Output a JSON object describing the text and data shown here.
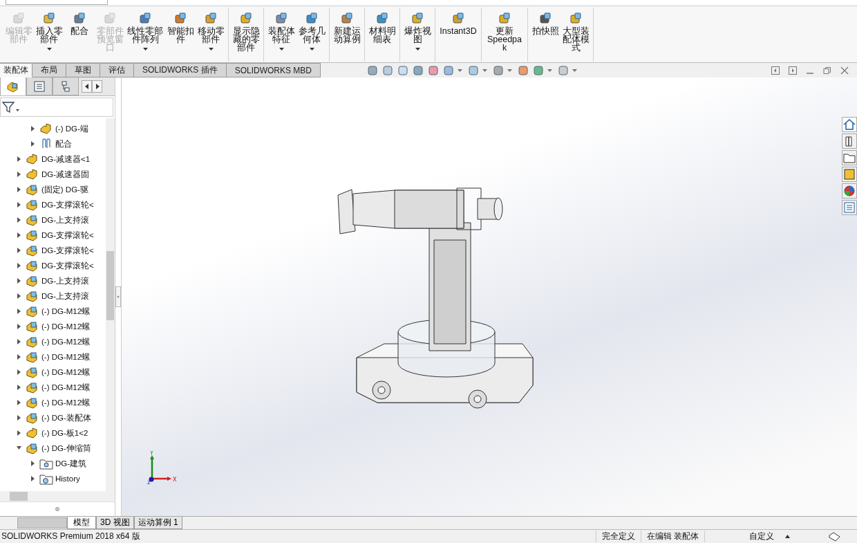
{
  "toolbar": {
    "groups": [
      {
        "items": [
          {
            "label": "编辑零部件",
            "disabled": true,
            "dropdown": false
          },
          {
            "label": "插入零部件",
            "disabled": false,
            "dropdown": true
          },
          {
            "label": "配合",
            "disabled": false,
            "dropdown": false
          },
          {
            "label": "零部件预览窗口",
            "disabled": true,
            "dropdown": false
          },
          {
            "label": "线性零部件阵列",
            "disabled": false,
            "dropdown": true
          },
          {
            "label": "智能扣件",
            "disabled": false,
            "dropdown": false
          },
          {
            "label": "移动零部件",
            "disabled": false,
            "dropdown": true
          }
        ]
      },
      {
        "items": [
          {
            "label": "显示隐藏的零部件",
            "disabled": false,
            "dropdown": false
          }
        ]
      },
      {
        "items": [
          {
            "label": "装配体特征",
            "disabled": false,
            "dropdown": true
          },
          {
            "label": "参考几何体",
            "disabled": false,
            "dropdown": true
          }
        ]
      },
      {
        "items": [
          {
            "label": "新建运动算例",
            "disabled": false,
            "dropdown": false
          }
        ]
      },
      {
        "items": [
          {
            "label": "材料明细表",
            "disabled": false,
            "dropdown": false
          }
        ]
      },
      {
        "items": [
          {
            "label": "爆炸视图",
            "disabled": false,
            "dropdown": true
          }
        ]
      },
      {
        "items": [
          {
            "label": "Instant3D",
            "disabled": false,
            "dropdown": false
          }
        ]
      },
      {
        "items": [
          {
            "label": "更新 Speedpak",
            "disabled": false,
            "dropdown": false
          }
        ]
      },
      {
        "items": [
          {
            "label": "拍快照",
            "disabled": false,
            "dropdown": false
          },
          {
            "label": "大型装配体模式",
            "disabled": false,
            "dropdown": false
          }
        ]
      }
    ]
  },
  "command_tabs": [
    {
      "label": "装配体",
      "selected": true
    },
    {
      "label": "布局",
      "selected": false
    },
    {
      "label": "草图",
      "selected": false
    },
    {
      "label": "评估",
      "selected": false
    },
    {
      "label": "SOLIDWORKS 插件",
      "selected": false
    },
    {
      "label": "SOLIDWORKS MBD",
      "selected": false
    }
  ],
  "tree": {
    "partial_parent_children": [
      {
        "label": "(-) DG-端",
        "kind": "part",
        "expanded": false
      },
      {
        "label": "配合",
        "kind": "mates",
        "expanded": false
      }
    ],
    "items": [
      {
        "label": "DG-减速器<1",
        "kind": "part",
        "expanded": false
      },
      {
        "label": "DG-减速器固",
        "kind": "part",
        "expanded": false
      },
      {
        "label": "(固定) DG-驱",
        "kind": "assembly",
        "expanded": false
      },
      {
        "label": "DG-支撑滚轮<",
        "kind": "assembly",
        "expanded": false
      },
      {
        "label": "DG-上支持滚",
        "kind": "assembly",
        "expanded": false
      },
      {
        "label": "DG-支撑滚轮<",
        "kind": "assembly",
        "expanded": false
      },
      {
        "label": "DG-支撑滚轮<",
        "kind": "assembly",
        "expanded": false
      },
      {
        "label": "DG-支撑滚轮<",
        "kind": "assembly",
        "expanded": false
      },
      {
        "label": "DG-上支持滚",
        "kind": "assembly",
        "expanded": false
      },
      {
        "label": "DG-上支持滚",
        "kind": "assembly",
        "expanded": false
      },
      {
        "label": "(-) DG-M12螺",
        "kind": "assembly",
        "expanded": false
      },
      {
        "label": "(-) DG-M12螺",
        "kind": "assembly",
        "expanded": false
      },
      {
        "label": "(-) DG-M12螺",
        "kind": "assembly",
        "expanded": false
      },
      {
        "label": "(-) DG-M12螺",
        "kind": "assembly",
        "expanded": false
      },
      {
        "label": "(-) DG-M12螺",
        "kind": "assembly",
        "expanded": false
      },
      {
        "label": "(-) DG-M12螺",
        "kind": "assembly",
        "expanded": false
      },
      {
        "label": "(-) DG-M12螺",
        "kind": "assembly",
        "expanded": false
      },
      {
        "label": "(-) DG-装配体",
        "kind": "assembly",
        "expanded": false
      },
      {
        "label": "(-) DG-板1<2",
        "kind": "part",
        "expanded": false
      },
      {
        "label": "(-) DG-伸缩筒",
        "kind": "assembly",
        "expanded": true,
        "children": [
          {
            "label": "DG-建筑",
            "kind": "folder",
            "expanded": false
          },
          {
            "label": "History",
            "kind": "history",
            "expanded": false
          }
        ]
      }
    ]
  },
  "triad": {
    "x_label": "X",
    "y_label": "Y",
    "z_label": "Z"
  },
  "bottom_tabs": [
    {
      "label": "模型",
      "selected": true
    },
    {
      "label": "3D 视图",
      "selected": false
    },
    {
      "label": "运动算例 1",
      "selected": false
    }
  ],
  "status_bar": {
    "product": "SOLIDWORKS Premium 2018 x64 版",
    "definition": "完全定义",
    "editing": "在编辑 装配体",
    "units": "自定义"
  }
}
